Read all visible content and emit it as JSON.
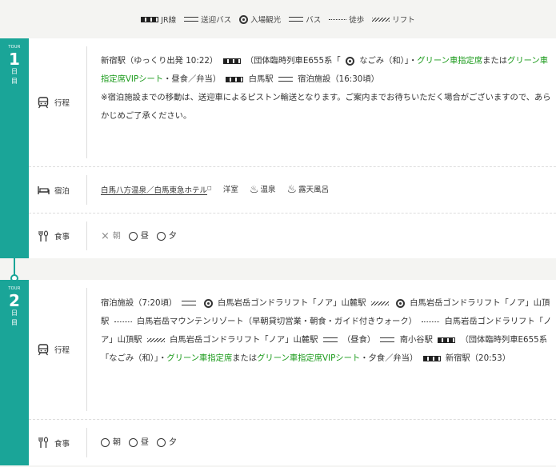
{
  "legend": {
    "jr": "JR線",
    "shuttle": "送迎バス",
    "sight": "入場観光",
    "bus": "バス",
    "walk": "徒歩",
    "lift": "リフト"
  },
  "tours": [
    {
      "tour_label": "TOUR",
      "number": "1",
      "day_chars": [
        "日",
        "目"
      ],
      "itinerary_label": "行程",
      "itinerary": {
        "p1": "新宿駅（ゆっくり出発 10:22）",
        "p2": "（団体臨時列車E655系「",
        "p3": "なごみ（和）」・",
        "g1": "グリーン車指定席",
        "p4": "または",
        "g2": "グリーン車指定席VIPシート",
        "p5": "・昼食／弁当）",
        "p6": "白馬駅",
        "p7": "宿泊施設（16:30頃）",
        "note": "※宿泊施設までの移動は、送迎車によるピストン輸送となります。ご案内までお待ちいただく場合がございますので、あらかじめご了承ください。"
      },
      "lodging_label": "宿泊",
      "lodging": {
        "hotel": "白馬八方温泉／白馬東急ホテル",
        "room": "洋室",
        "onsen": "温泉",
        "rotenburo": "露天風呂"
      },
      "meal_label": "食事",
      "meals": {
        "breakfast": "朝",
        "lunch": "昼",
        "dinner": "夕"
      }
    },
    {
      "tour_label": "TOUR",
      "number": "2",
      "day_chars": [
        "日",
        "目"
      ],
      "itinerary_label": "行程",
      "itinerary": {
        "p1": "宿泊施設（7:20頃）",
        "p2": "白馬岩岳ゴンドラリフト「ノア」山麓駅",
        "p3": "白馬岩岳ゴンドラリフト「ノア」山頂駅",
        "p4": "白馬岩岳マウンテンリゾート（早朝貸切営業・朝食・ガイド付きウォーク）",
        "p5": "白馬岩岳ゴンドラリフト「ノア」山頂駅",
        "p6": "白馬岩岳ゴンドラリフト「ノア」山麓駅",
        "p7": "（昼食）",
        "p8": "南小谷駅",
        "p9": "（団体臨時列車E655系「なごみ（和）」・",
        "g1": "グリーン車指定席",
        "p10": "または",
        "g2": "グリーン車指定席VIPシート",
        "p11": "・夕食／弁当）",
        "p12": "新宿駅（20:53）"
      },
      "meal_label": "食事",
      "meals": {
        "breakfast": "朝",
        "lunch": "昼",
        "dinner": "夕"
      }
    }
  ]
}
